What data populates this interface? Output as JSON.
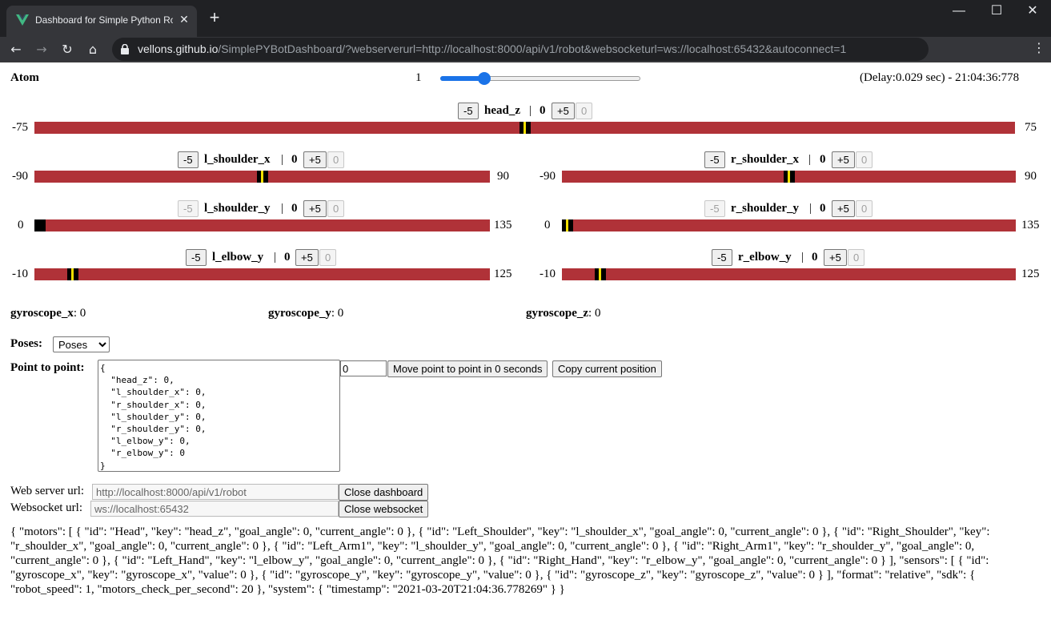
{
  "browser": {
    "tab_title": "Dashboard for Simple Python Ro",
    "url_host": "vellons.github.io",
    "url_path": "/SimplePYBotDashboard/?webserverurl=http://localhost:8000/api/v1/robot&websocketurl=ws://localhost:65432&autoconnect=1"
  },
  "header": {
    "robot_name": "Atom",
    "speed_value": "1",
    "speed_fraction": 0.2,
    "delay": "(Delay:0.029 sec) - 21:04:36:778"
  },
  "controls": {
    "minus": "-5",
    "plus": "+5",
    "zero": "0",
    "sep": "|"
  },
  "motors": {
    "head_z": {
      "key": "head_z",
      "value": "0",
      "min": "-75",
      "max": "75",
      "fraction": 0.5
    },
    "l_shoulder_x": {
      "key": "l_shoulder_x",
      "value": "0",
      "min": "-90",
      "max": "90",
      "fraction": 0.5
    },
    "r_shoulder_x": {
      "key": "r_shoulder_x",
      "value": "0",
      "min": "-90",
      "max": "90",
      "fraction": 0.5
    },
    "l_shoulder_y": {
      "key": "l_shoulder_y",
      "value": "0",
      "min": "0",
      "max": "135",
      "fraction": 0.0
    },
    "r_shoulder_y": {
      "key": "r_shoulder_y",
      "value": "0",
      "min": "0",
      "max": "135",
      "fraction": 0.0
    },
    "l_elbow_y": {
      "key": "l_elbow_y",
      "value": "0",
      "min": "-10",
      "max": "125",
      "fraction": 0.074
    },
    "r_elbow_y": {
      "key": "r_elbow_y",
      "value": "0",
      "min": "-10",
      "max": "125",
      "fraction": 0.074
    }
  },
  "sensors": {
    "gx_label": "gyroscope_x",
    "gx_value": ": 0",
    "gy_label": "gyroscope_y",
    "gy_value": ": 0",
    "gz_label": "gyroscope_z",
    "gz_value": ": 0"
  },
  "poses": {
    "label": "Poses:",
    "selected": "Poses"
  },
  "point_to_point": {
    "label": "Point to point:",
    "json": "{\n  \"head_z\": 0,\n  \"l_shoulder_x\": 0,\n  \"r_shoulder_x\": 0,\n  \"l_shoulder_y\": 0,\n  \"r_shoulder_y\": 0,\n  \"l_elbow_y\": 0,\n  \"r_elbow_y\": 0\n}",
    "seconds": "0",
    "move_button": "Move point to point in 0 seconds",
    "copy_button": "Copy current position"
  },
  "connection": {
    "webserver_label": "Web server url:",
    "webserver_value": "http://localhost:8000/api/v1/robot",
    "close_dashboard": "Close dashboard",
    "websocket_label": "Websocket url:",
    "websocket_value": "ws://localhost:65432",
    "close_websocket": "Close websocket"
  },
  "raw_state": "{ \"motors\": [ { \"id\": \"Head\", \"key\": \"head_z\", \"goal_angle\": 0, \"current_angle\": 0 }, { \"id\": \"Left_Shoulder\", \"key\": \"l_shoulder_x\", \"goal_angle\": 0, \"current_angle\": 0 }, { \"id\": \"Right_Shoulder\", \"key\": \"r_shoulder_x\", \"goal_angle\": 0, \"current_angle\": 0 }, { \"id\": \"Left_Arm1\", \"key\": \"l_shoulder_y\", \"goal_angle\": 0, \"current_angle\": 0 }, { \"id\": \"Right_Arm1\", \"key\": \"r_shoulder_y\", \"goal_angle\": 0, \"current_angle\": 0 }, { \"id\": \"Left_Hand\", \"key\": \"l_elbow_y\", \"goal_angle\": 0, \"current_angle\": 0 }, { \"id\": \"Right_Hand\", \"key\": \"r_elbow_y\", \"goal_angle\": 0, \"current_angle\": 0 } ], \"sensors\": [ { \"id\": \"gyroscope_x\", \"key\": \"gyroscope_x\", \"value\": 0 }, { \"id\": \"gyroscope_y\", \"key\": \"gyroscope_y\", \"value\": 0 }, { \"id\": \"gyroscope_z\", \"key\": \"gyroscope_z\", \"value\": 0 } ], \"format\": \"relative\", \"sdk\": { \"robot_speed\": 1, \"motors_check_per_second\": 20 }, \"system\": { \"timestamp\": \"2021-03-20T21:04:36.778269\" } }"
}
